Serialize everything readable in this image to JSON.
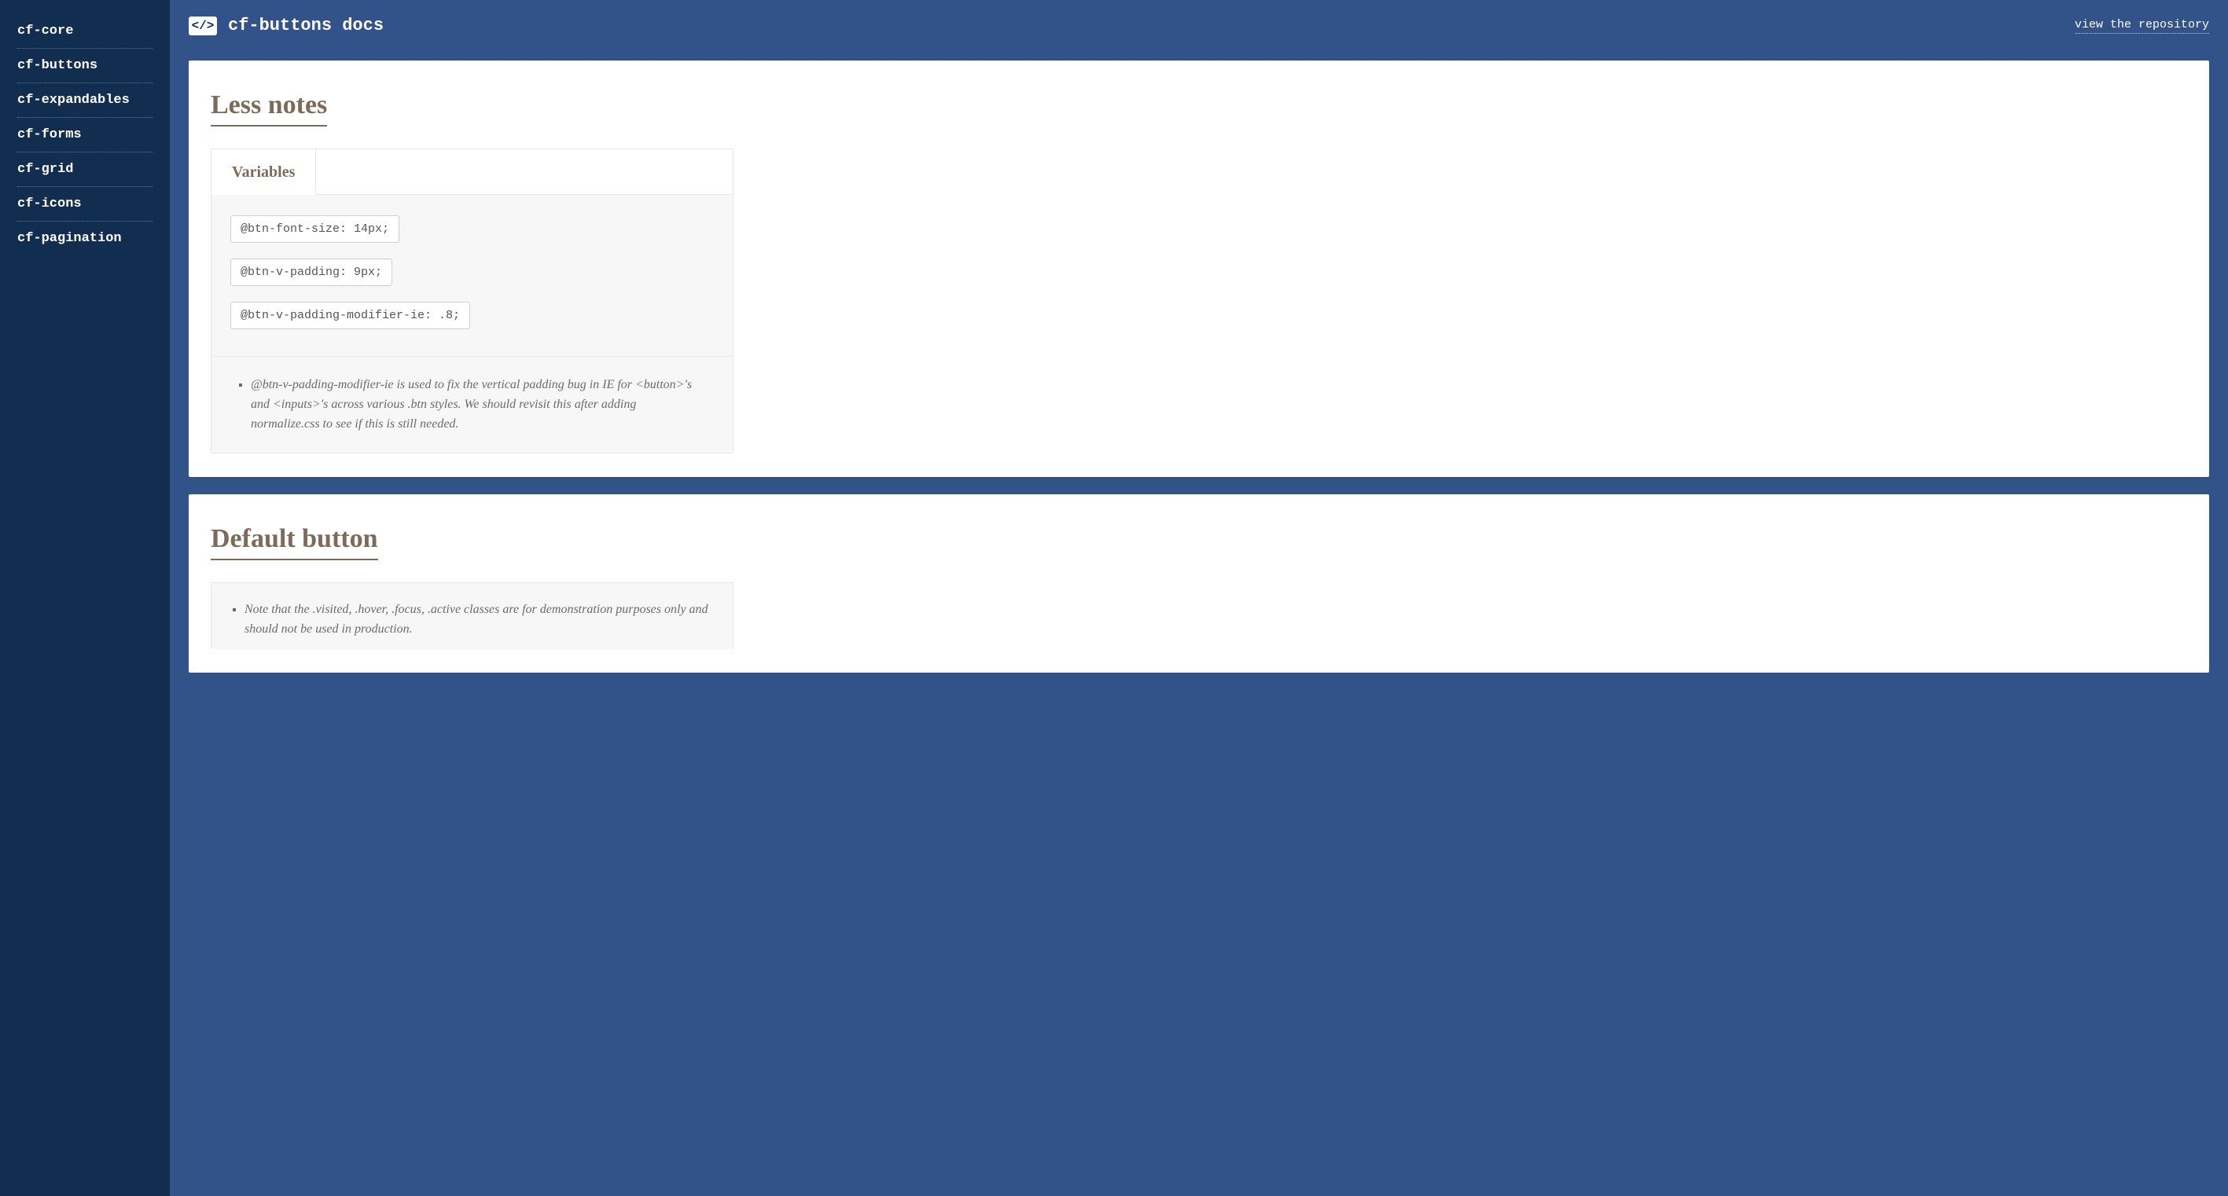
{
  "sidebar": {
    "items": [
      {
        "label": "cf-core"
      },
      {
        "label": "cf-buttons"
      },
      {
        "label": "cf-expandables"
      },
      {
        "label": "cf-forms"
      },
      {
        "label": "cf-grid"
      },
      {
        "label": "cf-icons"
      },
      {
        "label": "cf-pagination"
      }
    ]
  },
  "header": {
    "icon_glyph": "</>",
    "title": "cf-buttons docs",
    "repo_link": "view the repository"
  },
  "section1": {
    "heading": "Less notes",
    "tab_label": "Variables",
    "snippets": [
      "@btn-font-size: 14px;",
      "@btn-v-padding: 9px;",
      "@btn-v-padding-modifier-ie: .8;"
    ],
    "note": "@btn-v-padding-modifier-ie is used to fix the vertical padding bug in IE for <button>'s and <inputs>'s across various .btn styles. We should revisit this after adding normalize.css to see if this is still needed."
  },
  "section2": {
    "heading": "Default button",
    "note": "Note that the .visited, .hover, .focus, .active classes are for demonstration purposes only and should not be used in production."
  }
}
